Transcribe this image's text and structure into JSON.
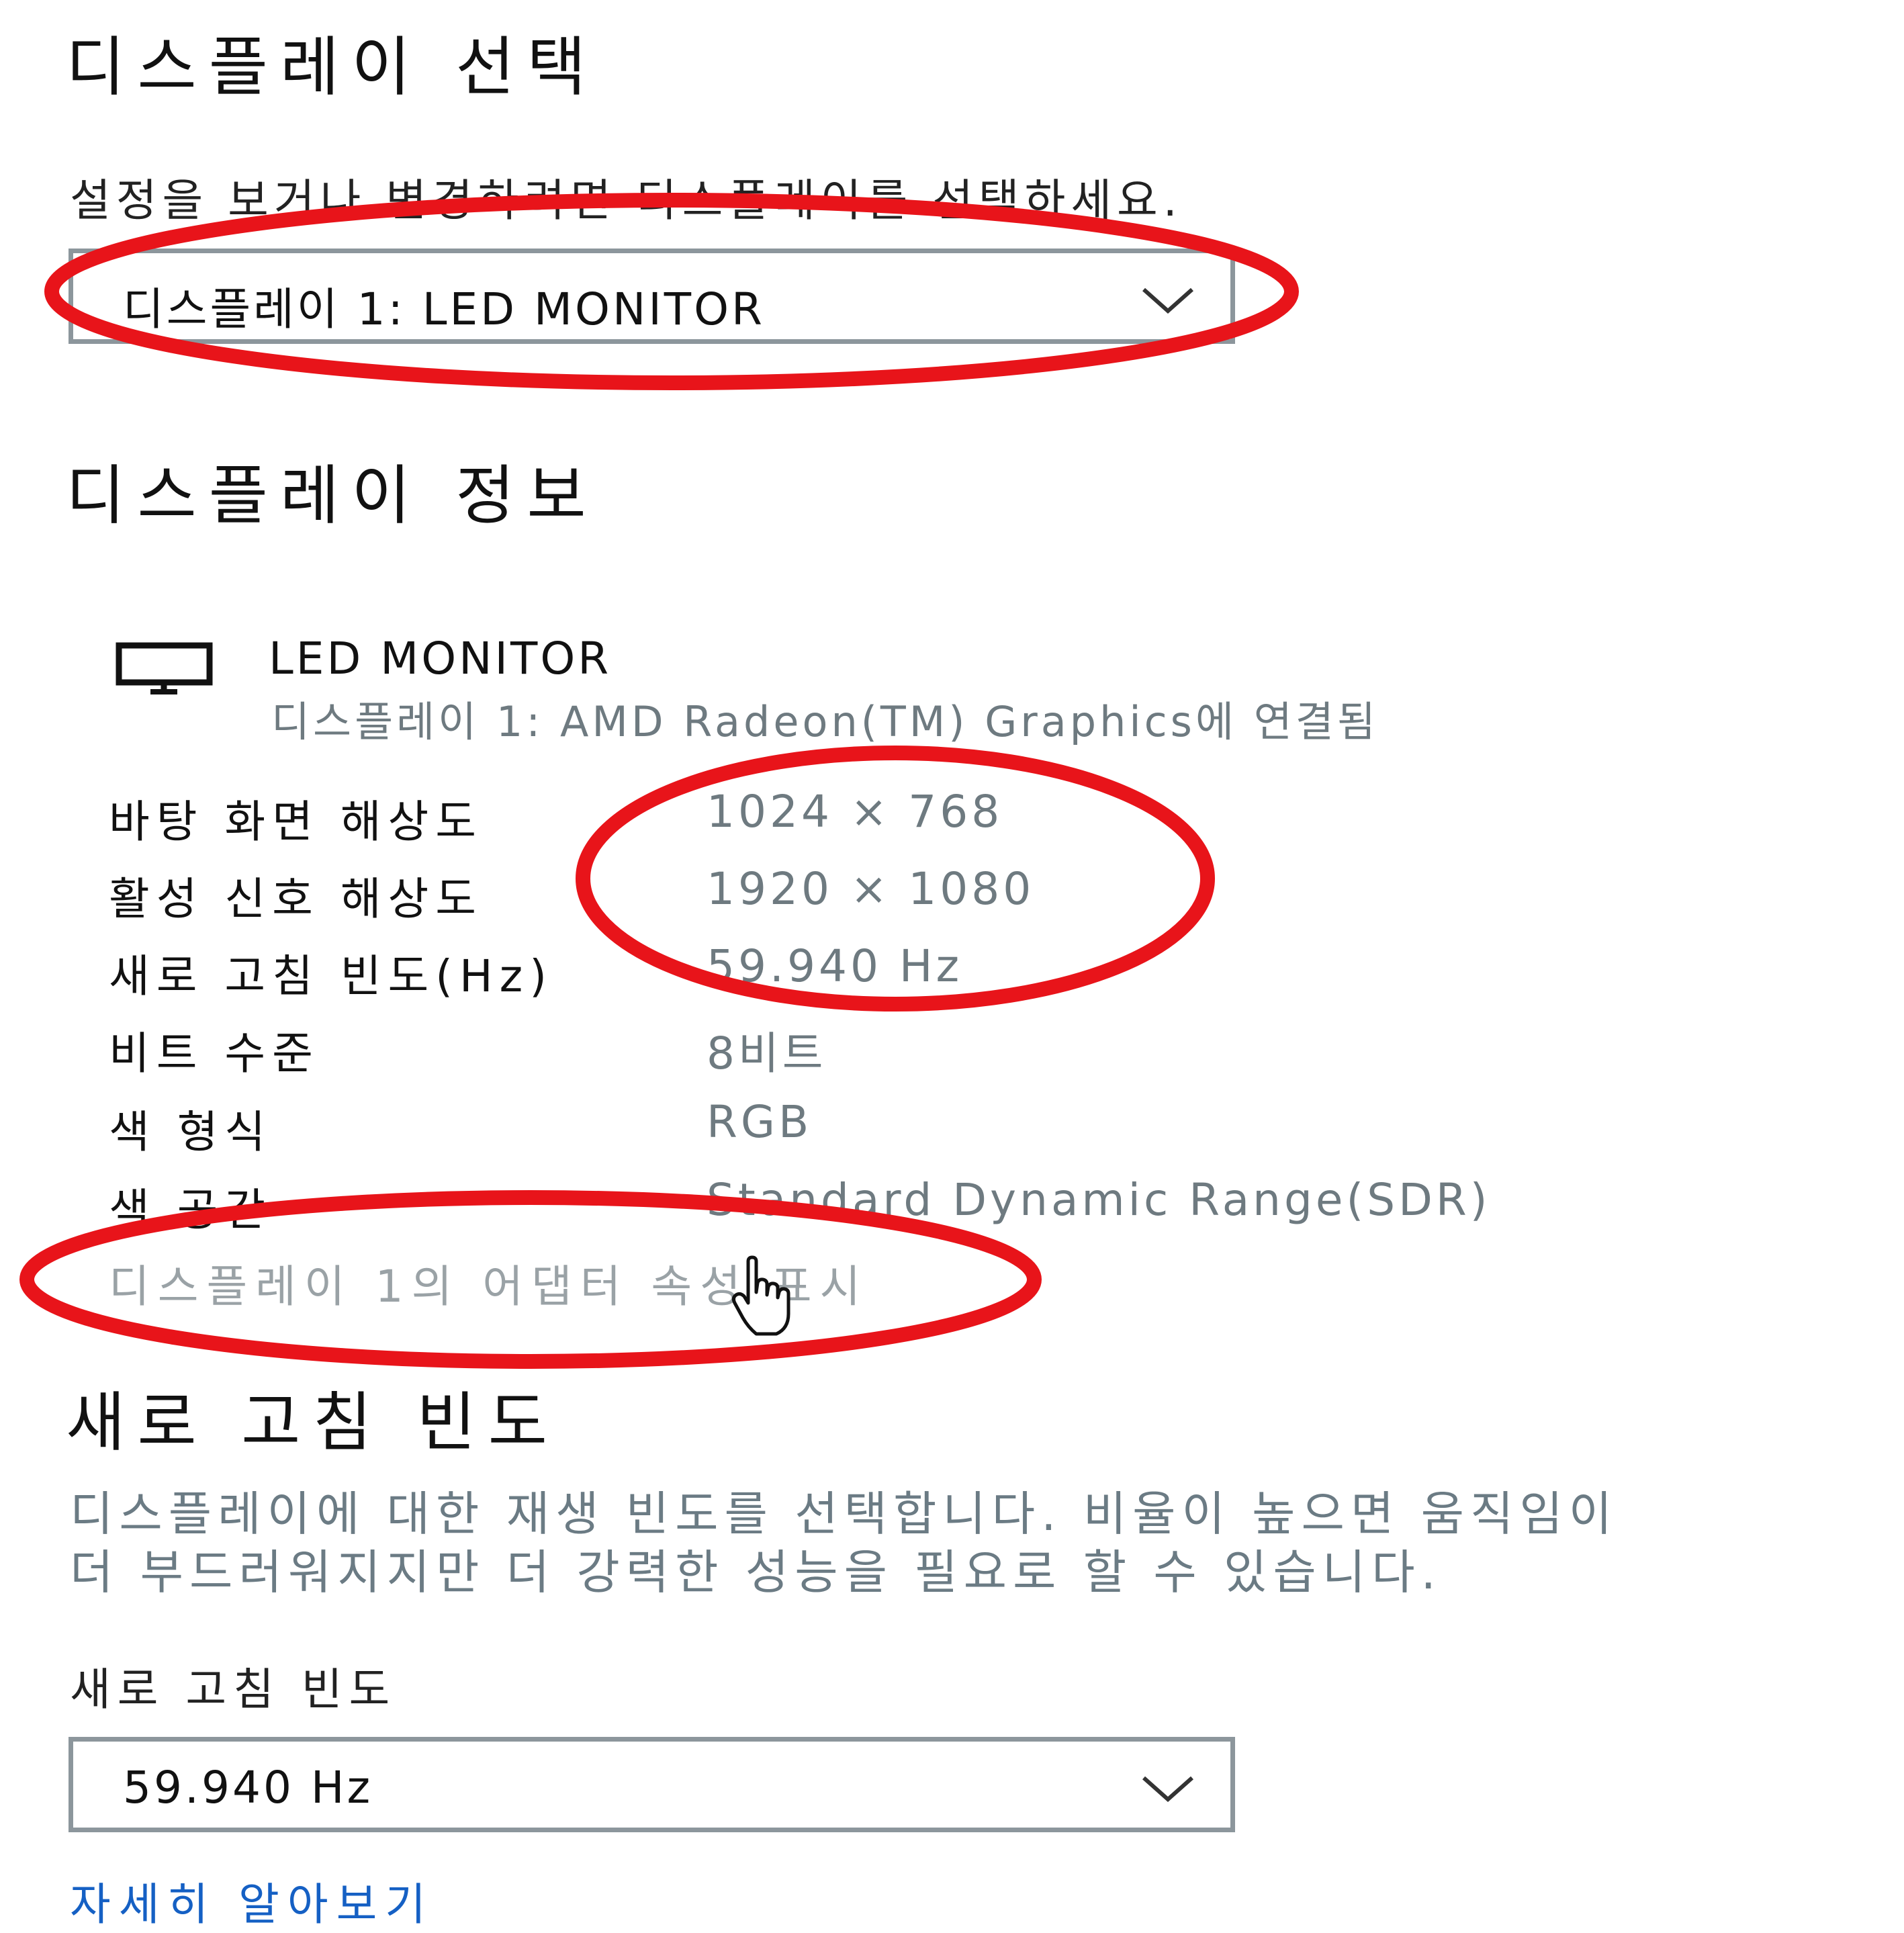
{
  "select_section": {
    "heading": "디스플레이 선택",
    "description": "설정을 보거나 변경하려면 디스플레이를 선택하세요.",
    "display_dropdown_value": "디스플레이 1: LED MONITOR"
  },
  "info_section": {
    "heading": "디스플레이 정보",
    "monitor_icon": "monitor-icon",
    "monitor_name": "LED MONITOR",
    "monitor_connection": "디스플레이 1: AMD Radeon(TM) Graphics에 연결됨",
    "rows": [
      {
        "label": "바탕 화면 해상도",
        "value": "1024 × 768"
      },
      {
        "label": "활성 신호 해상도",
        "value": "1920 × 1080"
      },
      {
        "label": "새로 고침 빈도(Hz)",
        "value": "59.940 Hz"
      },
      {
        "label": "비트 수준",
        "value": "8비트"
      },
      {
        "label": "색 형식",
        "value": "RGB"
      },
      {
        "label": "색 공간",
        "value": "Standard Dynamic Range(SDR)"
      }
    ],
    "adapter_link": "디스플레이 1의 어댑터 속성 표시"
  },
  "refresh_section": {
    "heading": "새로 고침 빈도",
    "description_line1": "디스플레이에 대한 재생 빈도를 선택합니다. 비율이 높으면 움직임이",
    "description_line2": "더 부드러워지지만 더 강력한 성능을 필요로 할 수 있습니다.",
    "field_label": "새로 고침 빈도",
    "dropdown_value": "59.940 Hz",
    "learn_more_link": "자세히 알아보기"
  },
  "colors": {
    "annotation_red": "#e8141a",
    "link_blue": "#1560c4",
    "muted_gray": "#6e7a80"
  }
}
